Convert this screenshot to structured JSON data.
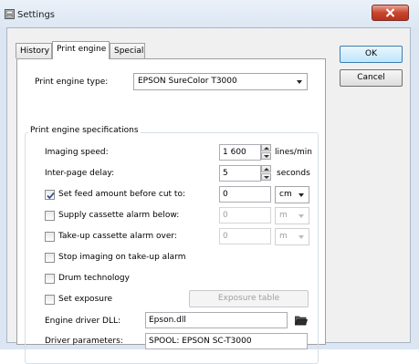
{
  "window": {
    "title": "Settings",
    "icon": "settings-window-icon"
  },
  "tabs": [
    {
      "label": "History",
      "active": false
    },
    {
      "label": "Print engine",
      "active": true
    },
    {
      "label": "Special",
      "active": false
    }
  ],
  "buttons": {
    "ok": "OK",
    "cancel": "Cancel"
  },
  "print_engine": {
    "type_label": "Print engine type:",
    "type_value": "EPSON SureColor T3000",
    "group_title": "Print engine specifications",
    "imaging_speed": {
      "label": "Imaging speed:",
      "value": "1 600",
      "unit": "lines/min"
    },
    "inter_page_delay": {
      "label": "Inter-page delay:",
      "value": "5",
      "unit": "seconds"
    },
    "feed_cut": {
      "label": "Set feed amount before cut to:",
      "checked": true,
      "value": "0",
      "unit": "cm"
    },
    "supply_alarm": {
      "label": "Supply cassette alarm below:",
      "checked": false,
      "value": "0",
      "unit": "m"
    },
    "takeup_alarm": {
      "label": "Take-up cassette alarm over:",
      "checked": false,
      "value": "0",
      "unit": "m"
    },
    "stop_imaging": {
      "label": "Stop imaging on take-up alarm",
      "checked": false
    },
    "drum": {
      "label": "Drum technology",
      "checked": false
    },
    "exposure": {
      "label": "Set exposure",
      "checked": false,
      "table_button": "Exposure table"
    },
    "driver_dll": {
      "label": "Engine driver DLL:",
      "value": "Epson.dll"
    },
    "driver_params": {
      "label": "Driver parameters:",
      "value": "SPOOL: EPSON SC-T3000"
    }
  },
  "colors": {
    "accent": "#3c7fb1",
    "close": "#c8452e",
    "window_frame": "#dbe6f2"
  }
}
